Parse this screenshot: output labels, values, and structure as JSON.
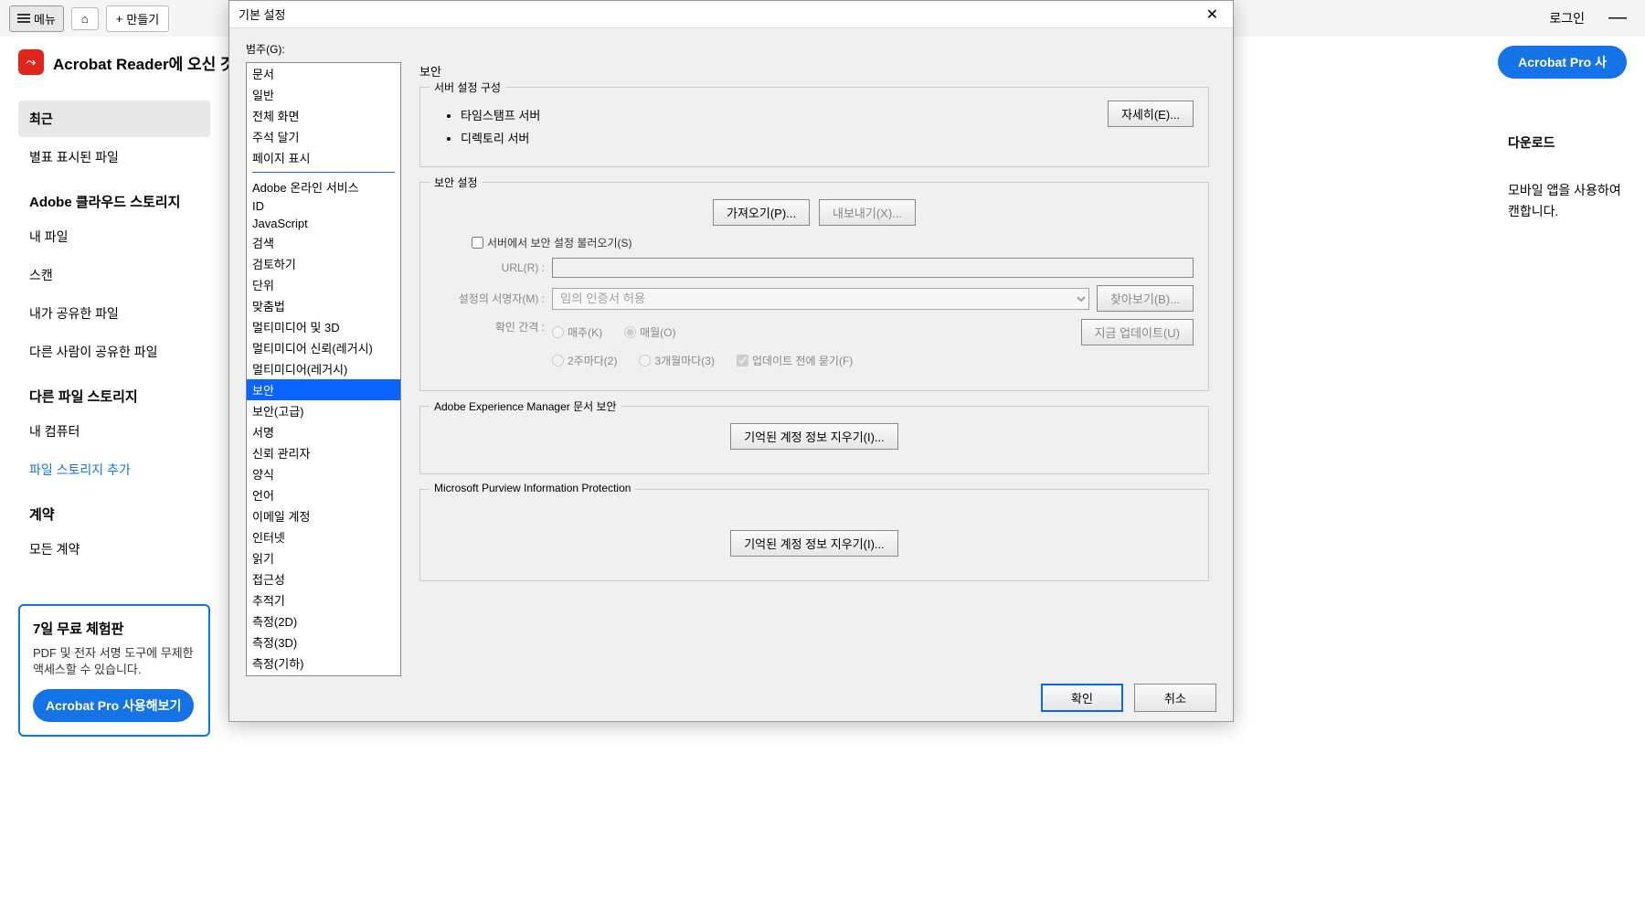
{
  "toolbar": {
    "menu": "메뉴",
    "create": "만들기",
    "login": "로그인"
  },
  "welcome": {
    "text": "Acrobat Reader에 오신 것을",
    "pro_button": "Acrobat Pro 사"
  },
  "sidebar": {
    "recent": "최근",
    "starred": "별표 표시된 파일",
    "cloud_header": "Adobe 클라우드 스토리지",
    "my_files": "내 파일",
    "scan": "스캔",
    "shared_by_me": "내가 공유한 파일",
    "shared_by_others": "다른 사람이 공유한 파일",
    "other_storage_header": "다른 파일 스토리지",
    "my_computer": "내 컴퓨터",
    "add_storage": "파일 스토리지 추가",
    "agreements_header": "계약",
    "all_agreements": "모든 계약"
  },
  "trial": {
    "title": "7일 무료 체험판",
    "desc": "PDF 및 전자 서명 도구에 무제한 액세스할 수 있습니다.",
    "button": "Acrobat Pro 사용해보기"
  },
  "right": {
    "download": "다운로드",
    "mobile1": "모바일 앱을 사용하여",
    "mobile2": "캔합니다."
  },
  "dialog": {
    "title": "기본 설정",
    "category_label": "범주(G):",
    "categories_top": [
      "문서",
      "일반",
      "전체 화면",
      "주석 달기",
      "페이지 표시"
    ],
    "categories_bottom": [
      "Adobe 온라인 서비스",
      "ID",
      "JavaScript",
      "검색",
      "검토하기",
      "단위",
      "맞춤법",
      "멀티미디어 및 3D",
      "멀티미디어 신뢰(레거시)",
      "멀티미디어(레거시)",
      "보안",
      "보안(고급)",
      "서명",
      "신뢰 관리자",
      "양식",
      "언어",
      "이메일 계정",
      "인터넷",
      "읽기",
      "접근성",
      "추적기",
      "측정(2D)",
      "측정(3D)",
      "측정(기하)"
    ],
    "selected_category": "보안",
    "pane_title": "보안",
    "group1": {
      "title": "서버 설정 구성",
      "items": [
        "타임스탬프 서버",
        "디렉토리 서버"
      ],
      "details_btn": "자세히(E)..."
    },
    "group2": {
      "title": "보안 설정",
      "import_btn": "가져오기(P)...",
      "export_btn": "내보내기(X)...",
      "load_from_server": "서버에서 보안 설정 불러오기(S)",
      "url_label": "URL(R) :",
      "signer_label": "설정의 서명자(M) :",
      "signer_value": "임의 인증서 허용",
      "browse_btn": "찾아보기(B)...",
      "interval_label": "확인 간격 :",
      "interval_opts": [
        "매주(K)",
        "매월(O)",
        "2주마다(2)",
        "3개월마다(3)"
      ],
      "ask_before_update": "업데이트 전에 묻기(F)",
      "update_now_btn": "지금 업데이트(U)"
    },
    "group3": {
      "title": "Adobe Experience Manager 문서 보안",
      "clear_btn": "기억된 계정 정보 지우기(I)..."
    },
    "group4": {
      "title": "Microsoft Purview Information Protection",
      "clear_btn": "기억된 계정 정보 지우기(I)..."
    },
    "ok": "확인",
    "cancel": "취소"
  }
}
